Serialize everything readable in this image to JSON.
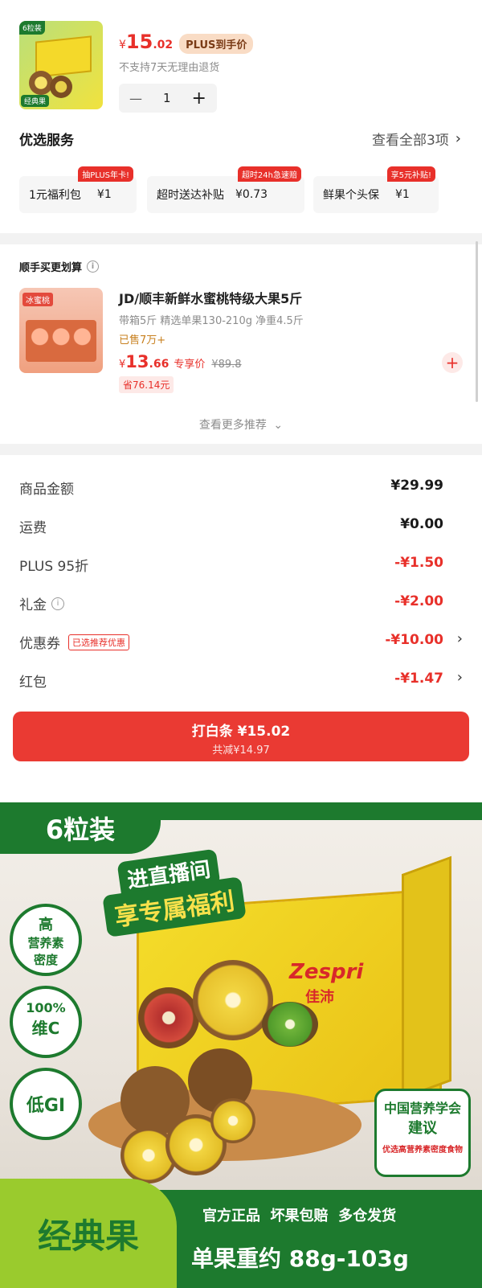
{
  "product": {
    "thumb_badge": "6粒装",
    "thumb_caption": "经典果",
    "price_symbol": "¥",
    "price_int": "15",
    "price_dec": ".02",
    "plus_tag": "PLUS到手价",
    "return_note": "不支持7天无理由退货",
    "qty_minus": "—",
    "qty_value": "1",
    "qty_plus": "+"
  },
  "services": {
    "title": "优选服务",
    "view_all": "查看全部3项",
    "items": [
      {
        "label": "1元福利包",
        "price": "¥1",
        "tag": "抽PLUS年卡!"
      },
      {
        "label": "超时送达补贴",
        "price": "¥0.73",
        "tag": "超时24h急速赔"
      },
      {
        "label": "鲜果个头保",
        "price": "¥1",
        "tag": "享5元补贴!"
      }
    ]
  },
  "recommend": {
    "title": "顺手买更划算",
    "info_icon": "info-icon",
    "thumb_label": "冰蜜桃",
    "name": "JD/顺丰新鲜水蜜桃特级大果5斤",
    "spec": "带箱5斤 精选单果130-210g 净重4.5斤",
    "sold": "已售7万+",
    "price_symbol": "¥",
    "price_int": "13",
    "price_dec": ".66",
    "price_tag": "专享价",
    "orig_price": "¥89.8",
    "save": "省76.14元",
    "more": "查看更多推荐"
  },
  "summary": {
    "rows": [
      {
        "label": "商品金额",
        "value": "¥29.99",
        "red": false
      },
      {
        "label": "运费",
        "value": "¥0.00",
        "red": false
      },
      {
        "label": "PLUS 95折",
        "value": "-¥1.50",
        "red": true
      },
      {
        "label": "礼金",
        "value": "-¥2.00",
        "red": true
      },
      {
        "label": "优惠券",
        "value": "-¥10.00",
        "red": true,
        "badge": "已选推荐优惠"
      },
      {
        "label": "红包",
        "value": "-¥1.47",
        "red": true
      }
    ]
  },
  "pay": {
    "label": "打白条 ¥15.02",
    "sub": "共减¥14.97"
  },
  "banner": {
    "pack": "6粒装",
    "live_line1": "进直播间",
    "live_line2": "享专属福利",
    "badge1_l1": "高",
    "badge1_l2": "营养素",
    "badge1_l3": "密度",
    "badge2_l1": "100%",
    "badge2_l2": "维C",
    "badge3": "低GI",
    "brand": "Zespri",
    "brand_cn": "佳沛",
    "assoc_l1": "中国营养学会",
    "assoc_l2": "建议",
    "assoc_l3": "优选高营养素密度食物",
    "classic": "经典果",
    "features": "官方正品  坏果包赔  多仓发货",
    "weight": "单果重约 88g-103g",
    "colors": {
      "green": "#1d7a2e",
      "lime": "#9acb2d",
      "yellow": "#f2d21b"
    }
  }
}
